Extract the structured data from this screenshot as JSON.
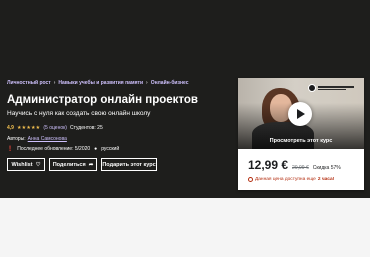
{
  "breadcrumb": [
    "Личностный рост",
    "Навыки учебы и развития памяти",
    "Онлайн-бизнес"
  ],
  "course": {
    "title": "Администратор онлайн проектов",
    "subtitle": "Научись с нуля как создать свою онлайн школу",
    "rating_value": "4,9",
    "stars": "★★★★★",
    "rating_count": "(5 оценок)",
    "students": "Студентов: 25",
    "authors_label": "Авторы:",
    "author_name": "Анна Самсонова",
    "last_updated": "Последнее обновление: 5/2020",
    "language": "русский"
  },
  "actions": {
    "wishlist": "Wishlist",
    "share": "Поделиться",
    "gift": "Подарить этот курс"
  },
  "sidebar": {
    "preview_label": "Просмотреть этот курс",
    "price_current": "12,99 €",
    "price_original": "29,99 €",
    "discount": "Скидка 57%",
    "countdown_text": "Данная цена доступна еще",
    "countdown_time": "2 часа!"
  },
  "colors": {
    "hero_bg": "#1e1e1c",
    "link_purple": "#cec0fc",
    "star_gold": "#f4c150",
    "alert_red": "#b32d0f"
  }
}
